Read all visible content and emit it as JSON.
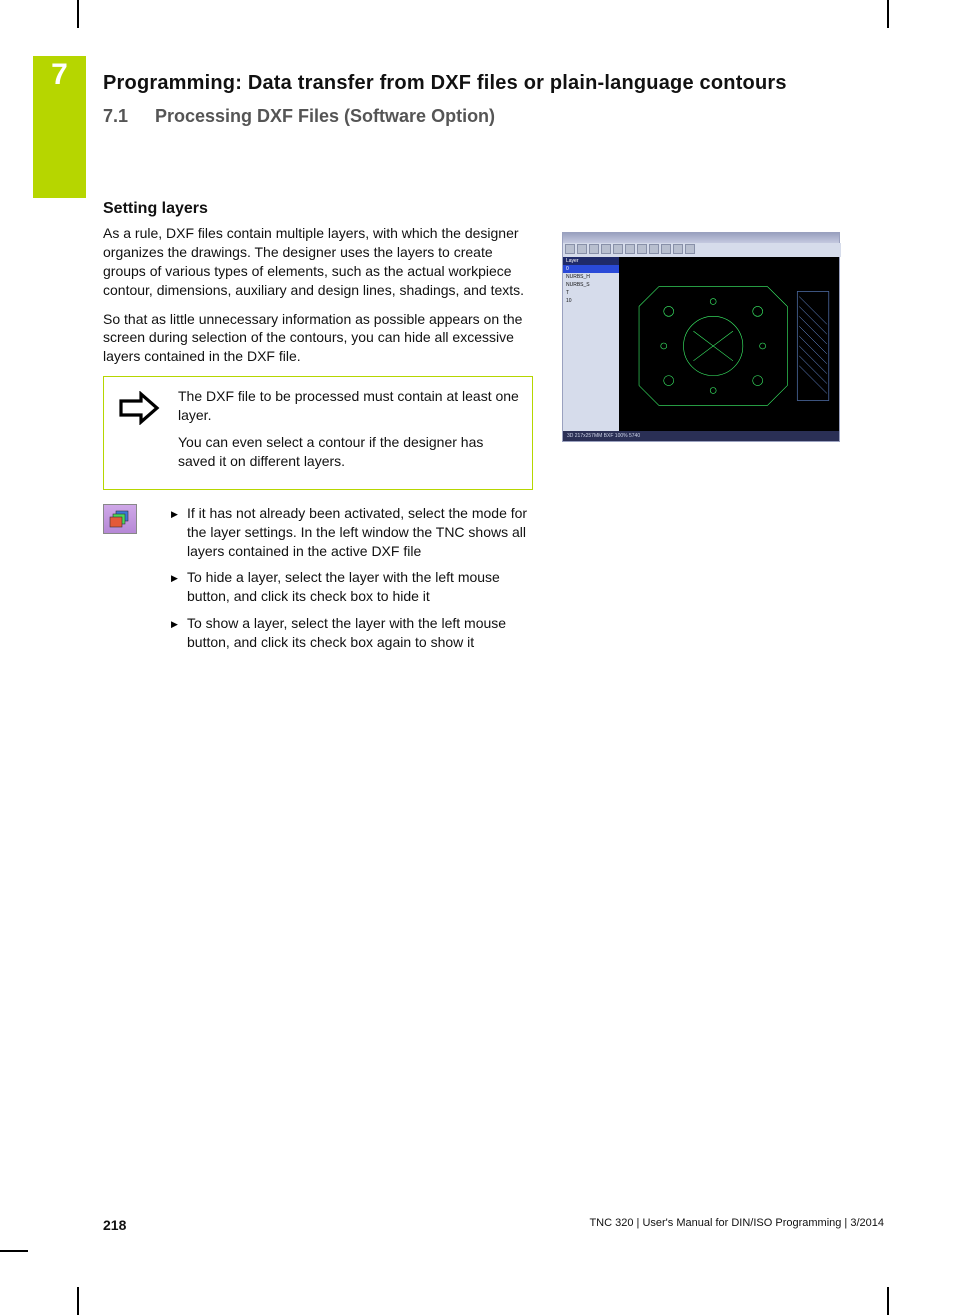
{
  "chapter_number": "7",
  "chapter_title": "Programming: Data transfer from DXF files or plain-language contours",
  "section_number": "7.1",
  "section_title": "Processing DXF Files (Software Option)",
  "heading": "Setting layers",
  "para1": "As a rule, DXF files contain multiple layers, with which the designer organizes the drawings. The designer uses the layers to create groups of various types of elements, such as the actual workpiece contour, dimensions, auxiliary and design lines, shadings, and texts.",
  "para2": "So that as little unnecessary information as possible appears on the screen during selection of the contours, you can hide all excessive layers contained in the DXF file.",
  "note": {
    "line1": "The DXF file to be processed must contain at least one layer.",
    "line2": "You can even select a contour if the designer has saved it on different layers."
  },
  "steps": [
    "If it has not already been activated, select the mode for the layer settings. In the left window the TNC shows all layers contained in the active DXF file",
    "To hide a layer, select the layer with the left mouse button, and click its check box to hide it",
    "To show a layer, select the layer with the left mouse button, and click its check box again to show it"
  ],
  "screenshot": {
    "titlebar": "",
    "side_header": "Layer",
    "side_selected": "0",
    "side_items": [
      "NURBS_H",
      "NURBS_S",
      "T",
      "10"
    ],
    "status": "3D  217x257MM  BXF  100%  5740"
  },
  "footer": {
    "page": "218",
    "doc": "TNC 320 | User's Manual for DIN/ISO Programming | 3/2014"
  }
}
